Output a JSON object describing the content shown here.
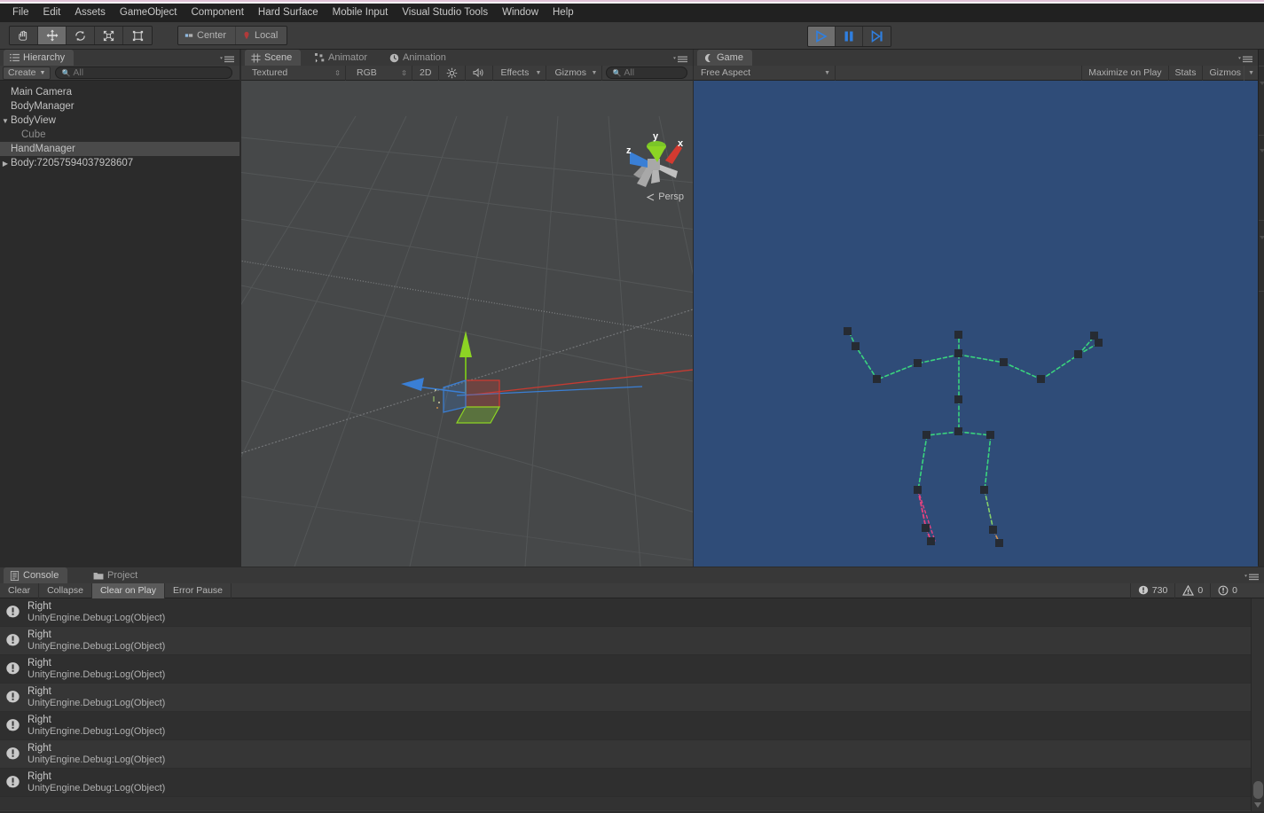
{
  "menubar": {
    "items": [
      {
        "label": "File"
      },
      {
        "label": "Edit"
      },
      {
        "label": "Assets"
      },
      {
        "label": "GameObject"
      },
      {
        "label": "Component"
      },
      {
        "label": "Hard Surface"
      },
      {
        "label": "Mobile Input"
      },
      {
        "label": "Visual Studio Tools"
      },
      {
        "label": "Window"
      },
      {
        "label": "Help"
      }
    ]
  },
  "toolbar": {
    "tools": [
      {
        "name": "hand-tool",
        "active": false
      },
      {
        "name": "move-tool",
        "active": true
      },
      {
        "name": "rotate-tool",
        "active": false
      },
      {
        "name": "scale-tool",
        "active": false
      },
      {
        "name": "rect-tool",
        "active": false
      }
    ],
    "pivot_label": "Center",
    "space_label": "Local",
    "play_label": "play",
    "pause_label": "pause",
    "step_label": "step"
  },
  "hierarchy": {
    "tab_label": "Hierarchy",
    "create_label": "Create",
    "search_placeholder": "All",
    "search_value": "",
    "items": [
      {
        "label": "Main Camera",
        "indent": 1,
        "arrow": "",
        "selected": false,
        "dim": false
      },
      {
        "label": "BodyManager",
        "indent": 1,
        "arrow": "",
        "selected": false,
        "dim": false
      },
      {
        "label": "BodyView",
        "indent": 0,
        "arrow": "▼",
        "selected": false,
        "dim": false
      },
      {
        "label": "Cube",
        "indent": 2,
        "arrow": "",
        "selected": false,
        "dim": true
      },
      {
        "label": "HandManager",
        "indent": 1,
        "arrow": "",
        "selected": true,
        "dim": false
      },
      {
        "label": "Body:72057594037928607",
        "indent": 0,
        "arrow": "▶",
        "selected": false,
        "dim": false
      }
    ]
  },
  "scene": {
    "tabs": [
      {
        "label": "Scene",
        "icon": "grid-icon",
        "active": true
      },
      {
        "label": "Animator",
        "icon": "animator-icon",
        "active": false
      },
      {
        "label": "Animation",
        "icon": "clock-icon",
        "active": false
      }
    ],
    "toolbar": {
      "shading_mode": "Textured",
      "color_mode": "RGB",
      "mode_2d": "2D",
      "lighting_icon": "sun-icon",
      "audio_icon": "speaker-icon",
      "effects_label": "Effects",
      "gizmos_label": "Gizmos",
      "search_placeholder": "All",
      "search_value": ""
    },
    "gizmo": {
      "axis_x": "x",
      "axis_y": "y",
      "axis_z": "z",
      "projection_label": "Persp"
    },
    "colors": {
      "background": "#464849",
      "grid": "#565859",
      "axis_x": "#d33a30",
      "axis_y": "#8cd424",
      "axis_z": "#3a7fd5"
    }
  },
  "game": {
    "tab_label": "Game",
    "aspect_label": "Free Aspect",
    "maximize_label": "Maximize on Play",
    "stats_label": "Stats",
    "gizmos_label": "Gizmos",
    "colors": {
      "background": "#2f4c78",
      "bone": "#3ad47e",
      "bone_highlight": "#e8427f",
      "joint": "#262b33"
    }
  },
  "console": {
    "tabs": [
      {
        "label": "Console",
        "icon": "console-icon",
        "active": true
      },
      {
        "label": "Project",
        "icon": "folder-icon",
        "active": false
      }
    ],
    "buttons": [
      {
        "label": "Clear",
        "toggled": false
      },
      {
        "label": "Collapse",
        "toggled": false
      },
      {
        "label": "Clear on Play",
        "toggled": true
      },
      {
        "label": "Error Pause",
        "toggled": false
      }
    ],
    "counts": {
      "errors": "730",
      "warnings": "0",
      "infos": "0"
    },
    "logs": [
      {
        "message": "Right",
        "stack": "UnityEngine.Debug:Log(Object)"
      },
      {
        "message": "Right",
        "stack": "UnityEngine.Debug:Log(Object)"
      },
      {
        "message": "Right",
        "stack": "UnityEngine.Debug:Log(Object)"
      },
      {
        "message": "Right",
        "stack": "UnityEngine.Debug:Log(Object)"
      },
      {
        "message": "Right",
        "stack": "UnityEngine.Debug:Log(Object)"
      },
      {
        "message": "Right",
        "stack": "UnityEngine.Debug:Log(Object)"
      },
      {
        "message": "Right",
        "stack": "UnityEngine.Debug:Log(Object)"
      }
    ]
  }
}
